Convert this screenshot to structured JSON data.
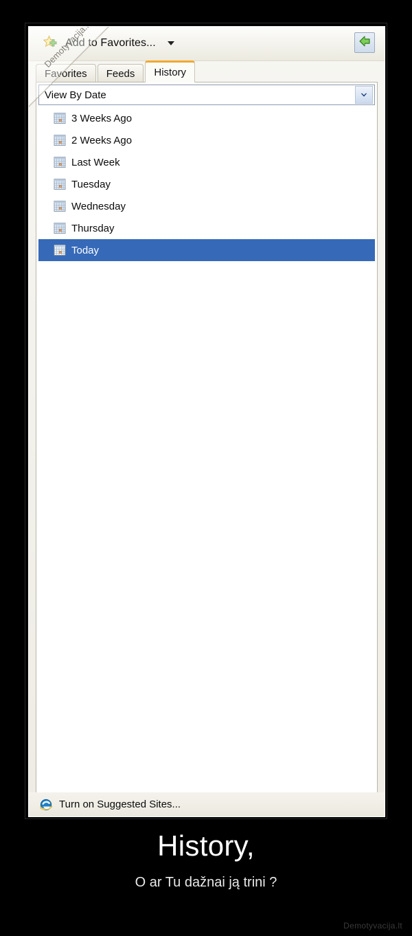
{
  "poster": {
    "title": "History,",
    "subtitle": "O ar Tu dažnai ją trini ?",
    "watermark": "Demotyvacija.lt",
    "corner_watermark": "Demotyvacija.lt",
    "background_color": "#000000",
    "title_color": "#ffffff"
  },
  "panel": {
    "toolbar": {
      "add_to_favorites_label": "Add to Favorites...",
      "add_to_favorites_icon": "star-plus-icon",
      "dropdown_caret_icon": "caret-down-icon",
      "pin_button_icon": "green-left-arrow-icon"
    },
    "tabs": [
      {
        "label": "Favorites",
        "active": false
      },
      {
        "label": "Feeds",
        "active": false
      },
      {
        "label": "History",
        "active": true
      }
    ],
    "active_tab_accent_color": "#f0a830",
    "view_by": {
      "selected": "View By Date",
      "arrow_icon": "chevron-down-icon",
      "options": [
        "View By Date"
      ]
    },
    "history_items": [
      {
        "label": "3 Weeks Ago",
        "icon": "calendar-icon",
        "selected": false
      },
      {
        "label": "2 Weeks Ago",
        "icon": "calendar-icon",
        "selected": false
      },
      {
        "label": "Last Week",
        "icon": "calendar-icon",
        "selected": false
      },
      {
        "label": "Tuesday",
        "icon": "calendar-icon",
        "selected": false
      },
      {
        "label": "Wednesday",
        "icon": "calendar-icon",
        "selected": false
      },
      {
        "label": "Thursday",
        "icon": "calendar-icon",
        "selected": false
      },
      {
        "label": "Today",
        "icon": "calendar-icon",
        "selected": true
      }
    ],
    "selection_color": "#3669b8",
    "footer": {
      "label": "Turn on Suggested Sites...",
      "icon": "internet-explorer-icon"
    }
  }
}
